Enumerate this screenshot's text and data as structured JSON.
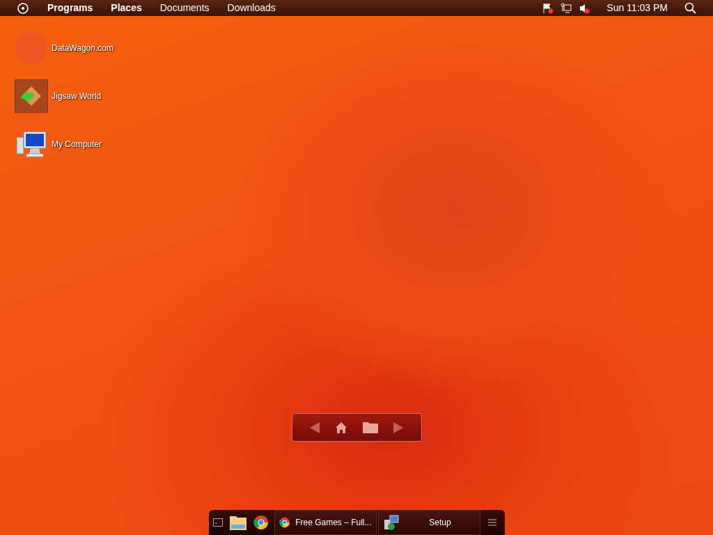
{
  "top_bar": {
    "menu": [
      {
        "label": "Programs",
        "bold": true
      },
      {
        "label": "Places",
        "bold": true
      },
      {
        "label": "Documents",
        "bold": false
      },
      {
        "label": "Downloads",
        "bold": false
      }
    ],
    "clock": "Sun 11:03 PM"
  },
  "desktop_icons": [
    {
      "kind": "globe",
      "label": "DataWagon.com"
    },
    {
      "kind": "puzzle",
      "label": "Jigsaw World"
    },
    {
      "kind": "computer",
      "label": "My Computer"
    }
  ],
  "taskbar": {
    "windows": [
      {
        "kind": "browser",
        "label": "Free Games – Full..."
      },
      {
        "kind": "installer",
        "label": "Setup"
      }
    ]
  }
}
